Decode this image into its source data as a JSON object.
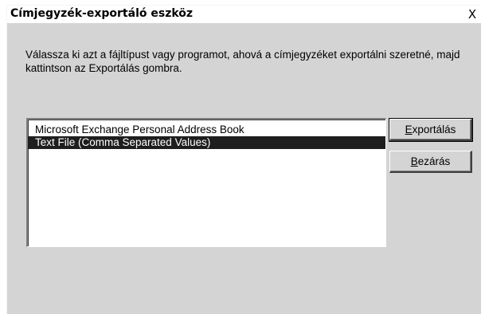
{
  "window": {
    "title": "Címjegyzék-exportáló eszköz",
    "close_glyph": "X"
  },
  "description": "Válassza ki azt a fájltípust vagy programot, ahová a címjegyzéket exportálni szeretné, majd kattintson az Exportálás gombra.",
  "list": {
    "items": [
      {
        "label": "Microsoft Exchange Personal Address Book",
        "selected": false
      },
      {
        "label": "Text File (Comma Separated Values)",
        "selected": true
      }
    ]
  },
  "buttons": {
    "export": {
      "accel": "E",
      "rest": "xportálás"
    },
    "close": {
      "accel": "B",
      "rest": "ezárás"
    }
  },
  "colors": {
    "dialog_bg": "#d4d4d4",
    "selection_bg": "#1e1e1e",
    "selection_fg": "#ffffff"
  },
  "icons": {
    "close": "close-icon"
  }
}
